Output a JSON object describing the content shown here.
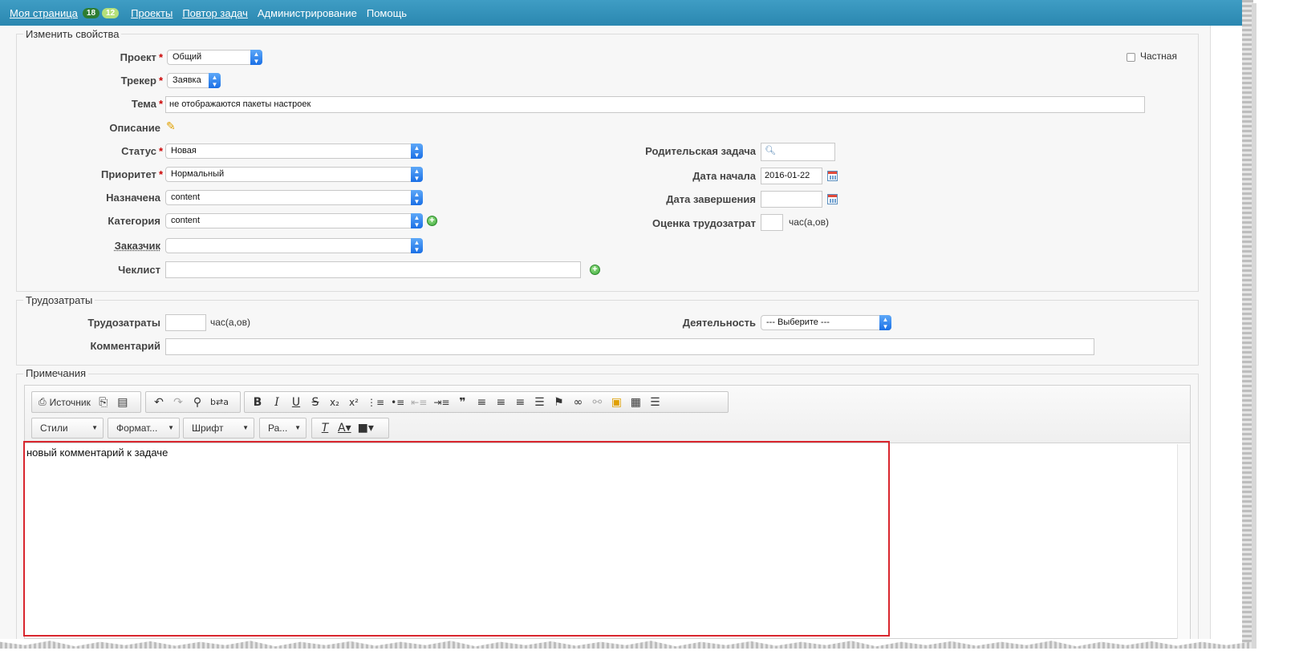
{
  "nav": {
    "items": [
      "Моя страница",
      "Проекты",
      "Повтор задач",
      "Администрирование",
      "Помощь"
    ],
    "badges": [
      "18",
      "12"
    ]
  },
  "properties": {
    "legend": "Изменить свойства",
    "project": {
      "label": "Проект",
      "value": "Общий"
    },
    "tracker": {
      "label": "Трекер",
      "value": "Заявка"
    },
    "subject": {
      "label": "Тема",
      "value": "не отображаются пакеты настроек"
    },
    "description": {
      "label": "Описание"
    },
    "private": {
      "label": "Частная"
    },
    "status": {
      "label": "Статус",
      "value": "Новая"
    },
    "priority": {
      "label": "Приоритет",
      "value": "Нормальный"
    },
    "assigned": {
      "label": "Назначена",
      "value": "content"
    },
    "category": {
      "label": "Категория",
      "value": "content"
    },
    "customer": {
      "label": "Заказчик",
      "value": ""
    },
    "checklist": {
      "label": "Чеклист",
      "value": ""
    },
    "parent": {
      "label": "Родительская задача",
      "value": ""
    },
    "start_date": {
      "label": "Дата начала",
      "value": "2016-01-22"
    },
    "due_date": {
      "label": "Дата завершения",
      "value": ""
    },
    "estimate": {
      "label": "Оценка трудозатрат",
      "unit": "час(а,ов)",
      "value": ""
    },
    "required_mark": "*"
  },
  "timelog": {
    "legend": "Трудозатраты",
    "hours": {
      "label": "Трудозатраты",
      "unit": "час(а,ов)",
      "value": ""
    },
    "activity": {
      "label": "Деятельность",
      "value": "--- Выберите ---"
    },
    "comment": {
      "label": "Комментарий",
      "value": ""
    }
  },
  "notes": {
    "legend": "Примечания",
    "source_label": "Источник",
    "combos": [
      "Стили",
      "Формат...",
      "Шрифт",
      "Ра..."
    ],
    "body_text": "новый комментарий к задаче"
  },
  "colors": {
    "topbar": "#2a87b0",
    "required": "#cc0000",
    "highlight": "#d9262e"
  }
}
